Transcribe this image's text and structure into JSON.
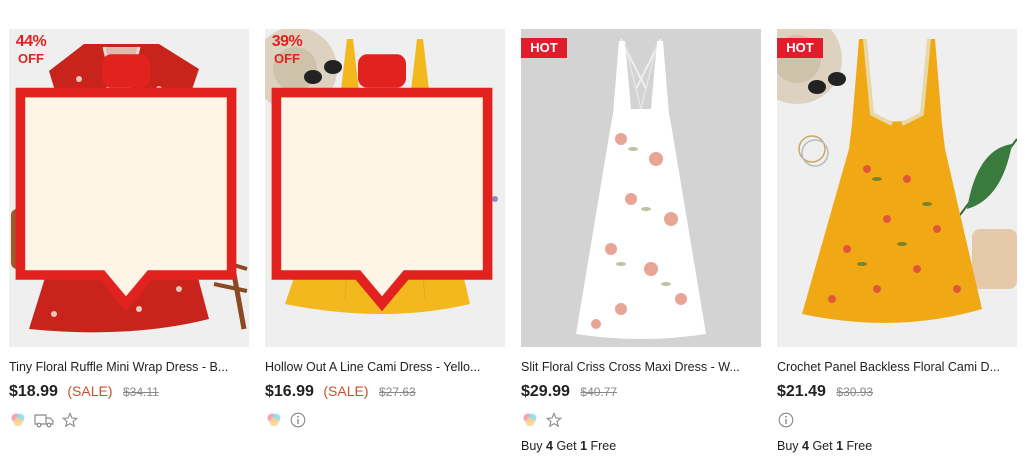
{
  "products": [
    {
      "title": "Tiny Floral Ruffle Mini Wrap Dress - B...",
      "price": "$18.99",
      "sale_label": "(SALE)",
      "old_price": "$34.11",
      "badge": {
        "type": "discount",
        "percent": "44%",
        "off": "OFF"
      },
      "dress_color": "#c8241c",
      "icons": [
        "color-swatch-icon",
        "free-shipping-truck-icon",
        "favorite-star-icon"
      ],
      "promo": null
    },
    {
      "title": "Hollow Out A Line Cami Dress - Yello...",
      "price": "$16.99",
      "sale_label": "(SALE)",
      "old_price": "$27.63",
      "badge": {
        "type": "discount",
        "percent": "39%",
        "off": "OFF"
      },
      "dress_color": "#f2b81e",
      "icons": [
        "color-swatch-icon",
        "info-icon"
      ],
      "promo": null
    },
    {
      "title": "Slit Floral Criss Cross Maxi Dress - W...",
      "price": "$29.99",
      "sale_label": "",
      "old_price": "$40.77",
      "badge": {
        "type": "hot",
        "label": "HOT"
      },
      "dress_color": "#ffffff",
      "icons": [
        "color-swatch-icon",
        "favorite-star-icon"
      ],
      "promo": {
        "pre": "Buy ",
        "n1": "4",
        "mid": " Get ",
        "n2": "1",
        "post": " Free"
      }
    },
    {
      "title": "Crochet Panel Backless Floral Cami D...",
      "price": "$21.49",
      "sale_label": "",
      "old_price": "$30.93",
      "badge": {
        "type": "hot",
        "label": "HOT"
      },
      "dress_color": "#f0a914",
      "icons": [
        "info-icon"
      ],
      "promo": {
        "pre": "Buy ",
        "n1": "4",
        "mid": " Get ",
        "n2": "1",
        "post": " Free"
      }
    }
  ],
  "colors": {
    "sale": "#c3512b",
    "hot_badge": "#e21b2d",
    "discount_tag": "#e1221e"
  }
}
